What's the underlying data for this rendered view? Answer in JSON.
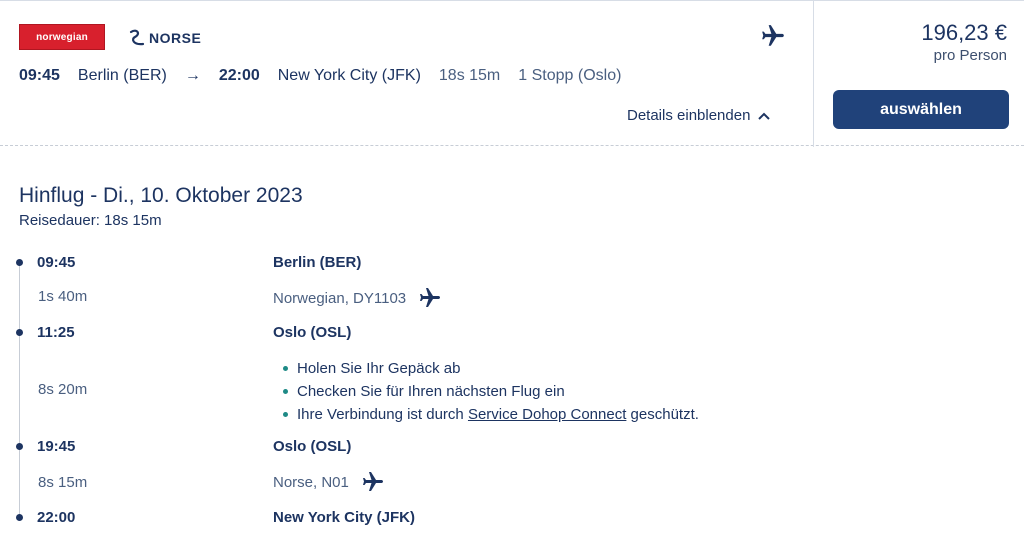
{
  "airlines": {
    "logo1_text": "norwegian",
    "logo2_text": "NORSE"
  },
  "route": {
    "dep_time": "09:45",
    "dep_place": "Berlin (BER)",
    "arrow": "→",
    "arr_time": "22:00",
    "arr_place": "New York City (JFK)",
    "duration": "18s 15m",
    "stops": "1 Stopp (Oslo)"
  },
  "details_toggle": "Details einblenden",
  "price": {
    "amount": "196,23 €",
    "unit": "pro Person",
    "select_label": "auswählen"
  },
  "outbound": {
    "title": "Hinflug - Di., 10. Oktober 2023",
    "travel_time": "Reisedauer: 18s 15m"
  },
  "timeline": [
    {
      "time": "09:45",
      "place": "Berlin (BER)"
    },
    {
      "duration": "1s 40m",
      "flight": "Norwegian, DY1103"
    },
    {
      "time": "11:25",
      "place": "Oslo (OSL)"
    },
    {
      "duration": "8s 20m"
    },
    {
      "time": "19:45",
      "place": "Oslo (OSL)"
    },
    {
      "duration": "8s 15m",
      "flight": "Norse, N01"
    },
    {
      "time": "22:00",
      "place": "New York City (JFK)"
    }
  ],
  "layover_notes": {
    "item1": "Holen Sie Ihr Gepäck ab",
    "item2": "Checken Sie für Ihren nächsten Flug ein",
    "item3_prefix": "Ihre Verbindung ist durch ",
    "item3_link": "Service Dohop Connect",
    "item3_suffix": " geschützt."
  },
  "colors": {
    "primary": "#1d3461",
    "button": "#20427a",
    "norwegian_red": "#d8202d",
    "bullet_teal": "#1e8a86"
  }
}
